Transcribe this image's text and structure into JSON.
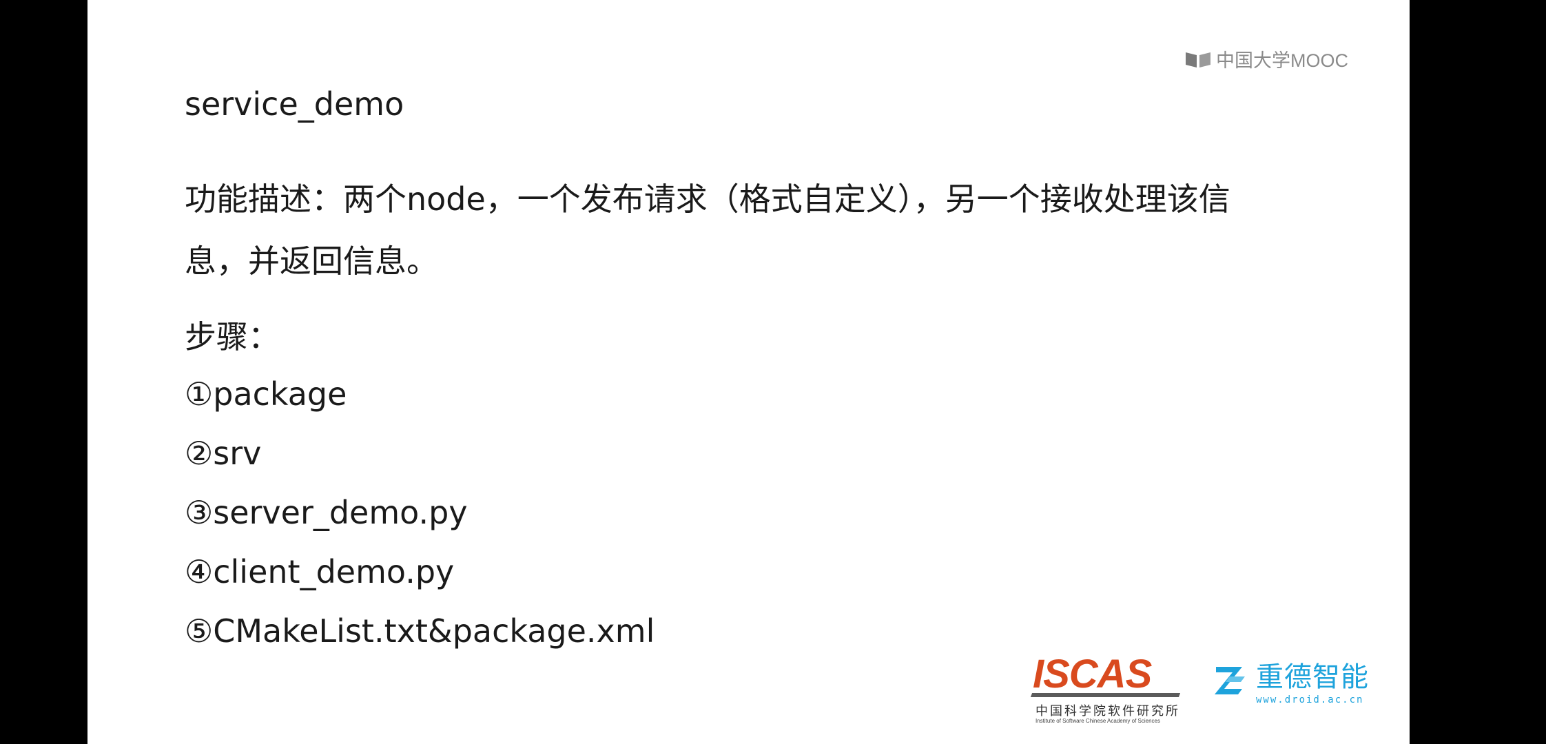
{
  "brand": {
    "mooc": "中国大学MOOC",
    "iscas_word": "ISCAS",
    "iscas_cn": "中国科学院软件研究所",
    "iscas_en": "Institute of Software Chinese Academy of Sciences",
    "zd_name": "重德智能",
    "zd_url": "www.droid.ac.cn",
    "colors": {
      "iscas_orange": "#d94a1e",
      "zd_blue": "#1ea3dc",
      "mooc_gray": "#8a8a8a"
    }
  },
  "slide": {
    "title": "service_demo",
    "desc_line1": "功能描述：两个node，一个发布请求（格式自定义），另一个接收处理该信",
    "desc_line2": "息，并返回信息。",
    "steps_label": "步骤：",
    "steps": [
      "①package",
      "②srv",
      "③server_demo.py",
      "④client_demo.py",
      "⑤CMakeList.txt&package.xml"
    ]
  }
}
